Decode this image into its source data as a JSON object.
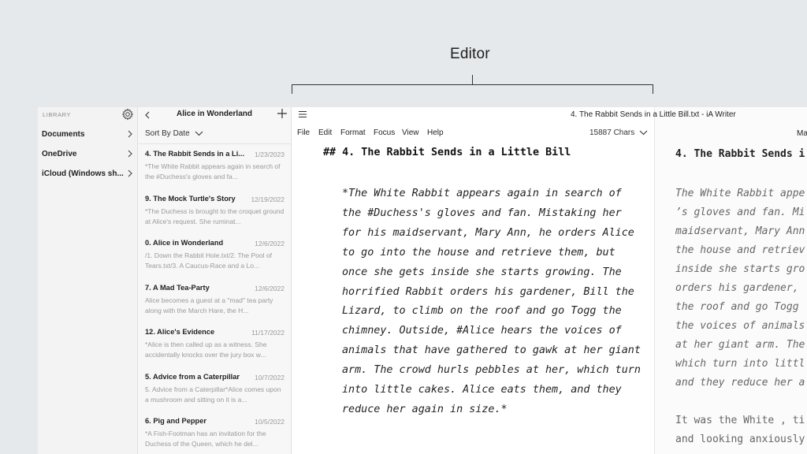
{
  "callout": {
    "label": "Editor"
  },
  "window": {
    "title": "4. The Rabbit Sends in a Little Bill.txt - iA Writer",
    "right_cut": "Mar"
  },
  "library": {
    "title": "LIBRARY",
    "items": [
      {
        "label": "Documents"
      },
      {
        "label": "OneDrive"
      },
      {
        "label": "iCloud (Windows sh..."
      }
    ]
  },
  "doclist": {
    "title": "Alice in Wonderland",
    "sort_label": "Sort By Date",
    "docs": [
      {
        "title": "4. The Rabbit Sends in a Li...",
        "date": "1/23/2023",
        "preview": "*The White Rabbit appears again in search of the #Duchess's gloves and fa..."
      },
      {
        "title": "9. The Mock Turtle's Story",
        "date": "12/19/2022",
        "preview": "*The Duchess is brought to the croquet ground at Alice's request. She ruminat..."
      },
      {
        "title": "0. Alice in Wonderland",
        "date": "12/6/2022",
        "preview": "/1. Down the Rabbit Hole.txt/2. The Pool of Tears.txt/3. A Caucus-Race and a Lo..."
      },
      {
        "title": "7. A Mad Tea-Party",
        "date": "12/6/2022",
        "preview": "Alice becomes a guest at a \"mad\" tea party along with the March Hare, the H..."
      },
      {
        "title": "12. Alice's Evidence",
        "date": "11/17/2022",
        "preview": "*Alice is then called up as a witness. She accidentally knocks over the jury box w..."
      },
      {
        "title": "5. Advice from a Caterpillar",
        "date": "10/7/2022",
        "preview": "5. Advice from a Caterpillar*Alice comes upon a mushroom and sitting on it is a..."
      },
      {
        "title": "6. Pig and Pepper",
        "date": "10/5/2022",
        "preview": "*A Fish-Footman has an invitation for the Duchess of the Queen, which he del..."
      }
    ]
  },
  "menubar": {
    "items": [
      "File",
      "Edit",
      "Format",
      "Focus",
      "View",
      "Help"
    ],
    "chars": "15887 Chars"
  },
  "editor": {
    "heading_marker": "##",
    "heading": "4. The Rabbit Sends in a Little Bill",
    "paragraph": "*The White Rabbit appears again in search of the #Duchess's gloves and fan. Mistaking her for his maidservant, Mary Ann, he orders Alice to go into the house and retrieve them, but once she gets inside she starts growing. The horrified Rabbit orders his gardener, Bill the Lizard, to climb on the roof and go Togg the chimney. Outside, #Alice hears the voices of animals that have gathered to gawk at her giant arm. The crowd hurls pebbles at her, which turn into little cakes. Alice eats them, and they reduce her again in size.*"
  },
  "preview": {
    "heading": "4. The Rabbit Sends i",
    "paragraph": "The White Rabbit appe\n’s gloves and fan. Mi\nmaidservant, Mary Ann\nthe house and retriev\ninside she starts gro\norders his gardener, \nthe roof and go Togg \nthe voices of animals\nat her giant arm. The\nwhich turn into littl\nand they reduce her a",
    "paragraph2": "It was the White , ti\nand looking anxiously"
  },
  "colors": {
    "background": "#e6e9ec",
    "window": "#ffffff",
    "sidebar": "#f3f3f3",
    "doclist": "#f7f7f7",
    "muted_text": "#9a9a9a"
  }
}
